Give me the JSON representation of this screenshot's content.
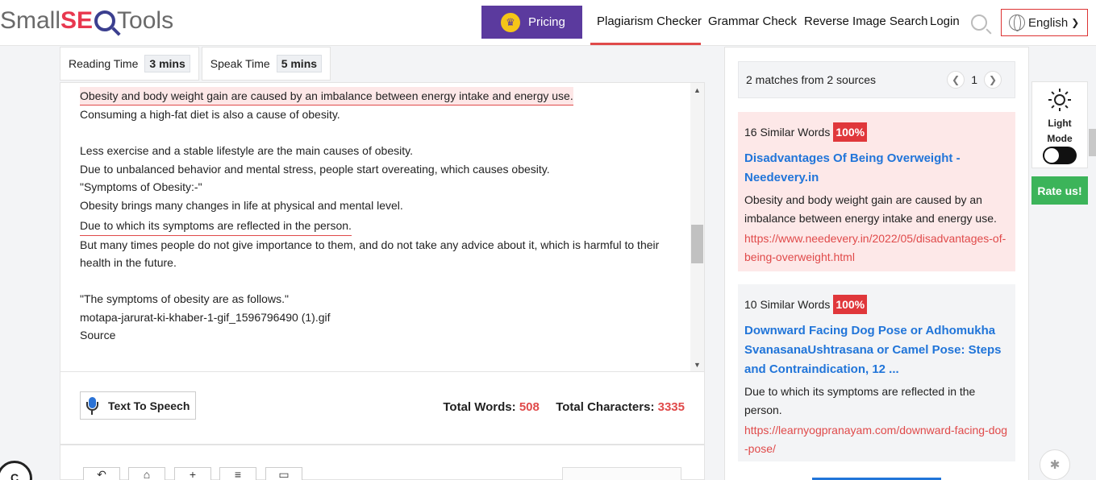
{
  "header": {
    "logo": {
      "part1": "Small",
      "part2": "SE",
      "part3": "Tools"
    },
    "pricing_label": "Pricing",
    "nav": [
      {
        "label": "Plagiarism Checker"
      },
      {
        "label": "Grammar Check"
      },
      {
        "label": "Reverse Image Search"
      },
      {
        "label": "Login"
      }
    ],
    "language": "English"
  },
  "stats": {
    "reading_time_label": "Reading Time",
    "reading_time_value": "3 mins",
    "speak_time_label": "Speak Time",
    "speak_time_value": "5 mins"
  },
  "editor": {
    "lines": [
      "Obesity and body weight gain are caused by an imbalance between energy intake and energy use.",
      "Consuming a high-fat diet is also a cause of obesity.",
      "Less exercise and a stable lifestyle are the main causes of obesity.",
      "Due to unbalanced behavior and mental stress, people start overeating, which causes obesity.",
      "\"Symptoms of Obesity:-\"",
      "Obesity brings many changes in life at physical and mental level.",
      "Due to which its symptoms are reflected in the person.",
      "But many times people do not give importance to them, and do not take any advice about it, which is harmful to their health in the future.",
      "\"The symptoms of obesity are as follows.\"",
      "motapa-jarurat-ki-khaber-1-gif_1596796490 (1).gif",
      "Source"
    ]
  },
  "footer": {
    "tts_label": "Text To Speech",
    "total_words_label": "Total Words:",
    "total_words": "508",
    "total_chars_label": "Total Characters:",
    "total_chars": "3335"
  },
  "results": {
    "summary": "2 matches from 2 sources",
    "page": "1",
    "sources": [
      {
        "similar": "16 Similar Words",
        "percent": "100%",
        "title": "Disadvantages Of Being Overweight - Needevery.in",
        "text": "Obesity and body weight gain are caused by an imbalance between energy intake and energy use.",
        "url": "https://www.needevery.in/2022/05/disadvantages-of-being-overweight.html"
      },
      {
        "similar": "10 Similar Words",
        "percent": "100%",
        "title": "Downward Facing Dog Pose or Adhomukha SvanasanaUshtrasana or Camel Pose: Steps and Contraindication, 12 ...",
        "text": "Due to which its symptoms are reflected in the person.",
        "url": "https://learnyogpranayam.com/downward-facing-dog-pose/"
      }
    ]
  },
  "widgets": {
    "light_mode_line1": "Light",
    "light_mode_line2": "Mode",
    "rate_label": "Rate us!",
    "chat_letter": "C"
  },
  "colors": {
    "accent_red": "#e04a4a",
    "pricing_purple": "#5b3a9e",
    "link_blue": "#2175d9",
    "rate_green": "#3cb45a"
  }
}
